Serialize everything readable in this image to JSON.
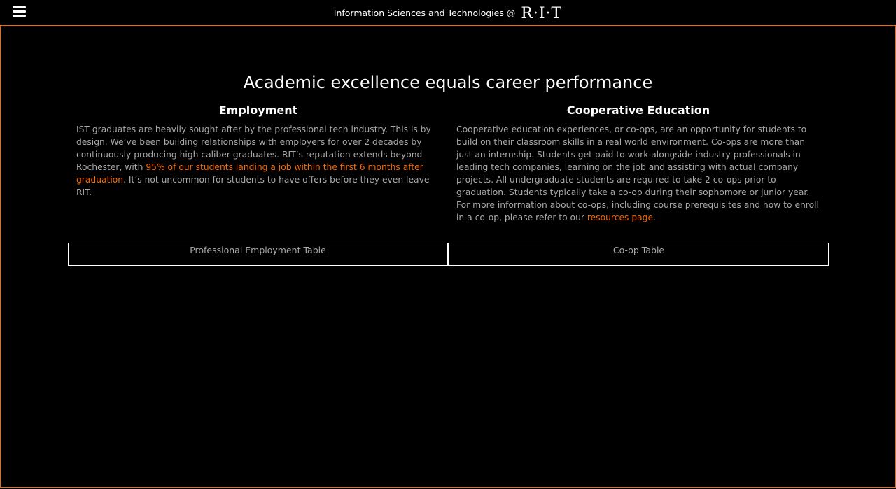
{
  "header": {
    "brand_text": "Information Sciences and Technologies @",
    "brand_logo": "R·I·T",
    "menu_icon": "hamburger-menu-icon"
  },
  "main": {
    "headline": "Academic excellence equals career performance",
    "employment": {
      "title": "Employment",
      "text_before": "IST graduates are heavily sought after by the professional tech industry. This is by design. We’ve been building relationships with employers for over 2 decades by continuously producing high caliber graduates. RIT’s reputation extends beyond Rochester, with ",
      "highlight": "95% of our students landing a job within the first 6 months after graduation",
      "text_after": ". It’s not uncommon for students to have offers before they even leave RIT."
    },
    "coop": {
      "title": "Cooperative Education",
      "text_before": "Cooperative education experiences, or co-ops, are an opportunity for students to build on their classroom skills in a real world environment. Co-ops are more than just an internship. Students get paid to work alongside industry professionals in leading tech companies, learning on the job and assisting with actual company projects. All undergraduate students are required to take 2 co-ops prior to graduation. Students typically take a co-op during their sophomore or junior year. For more information about co-ops, including course prerequisites and how to enroll in a co-op, please refer to our ",
      "link": "resources page",
      "text_after": "."
    },
    "tabs": [
      {
        "label": "Professional Employment Table"
      },
      {
        "label": "Co-op Table"
      }
    ]
  },
  "colors": {
    "accent": "#f76902",
    "background": "#000000",
    "text_muted": "#a8a8a8",
    "text_primary": "#ffffff"
  }
}
